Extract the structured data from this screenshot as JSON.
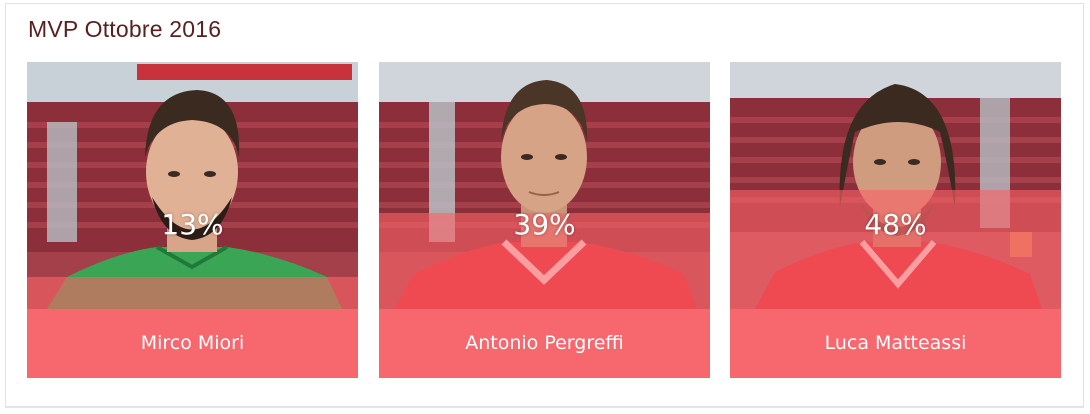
{
  "widget": {
    "title": "MVP Ottobre 2016"
  },
  "players": [
    {
      "name": "Mirco Miori",
      "percent_label": "13%",
      "vote_share": 0.13,
      "shirt_color": "#3aa655",
      "photo_alt": "player-photo"
    },
    {
      "name": "Antonio Pergreffi",
      "percent_label": "39%",
      "vote_share": 0.39,
      "shirt_color": "#e0232d",
      "photo_alt": "player-photo"
    },
    {
      "name": "Luca Matteassi",
      "percent_label": "48%",
      "vote_share": 0.48,
      "shirt_color": "#e0232d",
      "photo_alt": "player-photo"
    }
  ],
  "colors": {
    "accent": "#f6686e",
    "title": "#5a1f1f"
  }
}
